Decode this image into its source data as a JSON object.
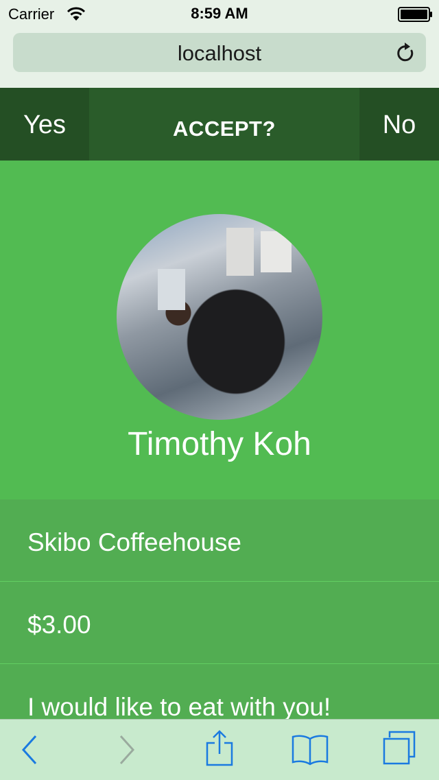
{
  "status_bar": {
    "carrier": "Carrier",
    "time": "8:59 AM"
  },
  "browser": {
    "url": "localhost"
  },
  "header": {
    "yes_label": "Yes",
    "title": "ACCEPT?",
    "no_label": "No"
  },
  "profile": {
    "name": "Timothy Koh"
  },
  "details": {
    "place": "Skibo Coffeehouse",
    "amount": "$3.00",
    "message": "I would like to eat with you!"
  },
  "colors": {
    "header_bg": "#2a5c2a",
    "button_bg": "#244f24",
    "profile_bg": "#52bb52",
    "row_bg": "#52ad52",
    "toolbar_accent": "#1a7ae0"
  },
  "icons": [
    "wifi-icon",
    "battery-icon",
    "reload-icon",
    "back-icon",
    "forward-icon",
    "share-icon",
    "bookmarks-icon",
    "tabs-icon"
  ]
}
